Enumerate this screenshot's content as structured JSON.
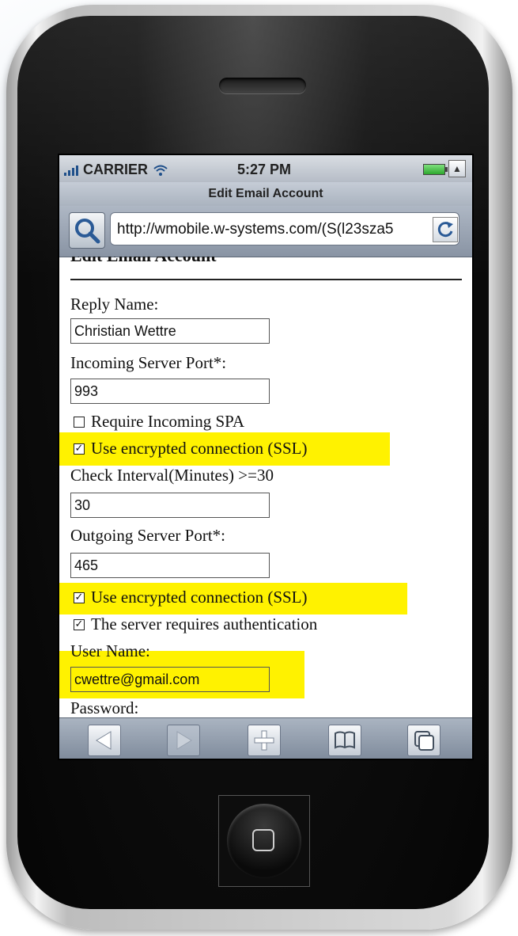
{
  "status": {
    "carrier": "CARRIER",
    "time": "5:27 PM"
  },
  "browser": {
    "page_title": "Edit Email Account",
    "url": "http://wmobile.w-systems.com/(S(l23sza5"
  },
  "form": {
    "heading": "Edit Email Account",
    "reply_name_label": "Reply Name:",
    "reply_name_value": "Christian Wettre",
    "incoming_port_label": "Incoming Server Port*:",
    "incoming_port_value": "993",
    "require_spa_label": "Require Incoming SPA",
    "require_spa_checked": false,
    "incoming_ssl_label": "Use encrypted connection (SSL)",
    "incoming_ssl_checked": true,
    "check_interval_label": "Check Interval(Minutes) >=30",
    "check_interval_value": "30",
    "outgoing_port_label": "Outgoing Server Port*:",
    "outgoing_port_value": "465",
    "outgoing_ssl_label": "Use encrypted connection (SSL)",
    "outgoing_ssl_checked": true,
    "auth_label": "The server requires authentication",
    "auth_checked": true,
    "user_name_label": "User Name:",
    "user_name_value": "cwettre@gmail.com",
    "password_label": "Password:"
  },
  "toolbar": {
    "icons": [
      "back-icon",
      "forward-icon",
      "add-icon",
      "bookmarks-icon",
      "pages-icon"
    ]
  },
  "colors": {
    "highlight": "#fff200",
    "browser_chrome": "#aab4c1"
  }
}
